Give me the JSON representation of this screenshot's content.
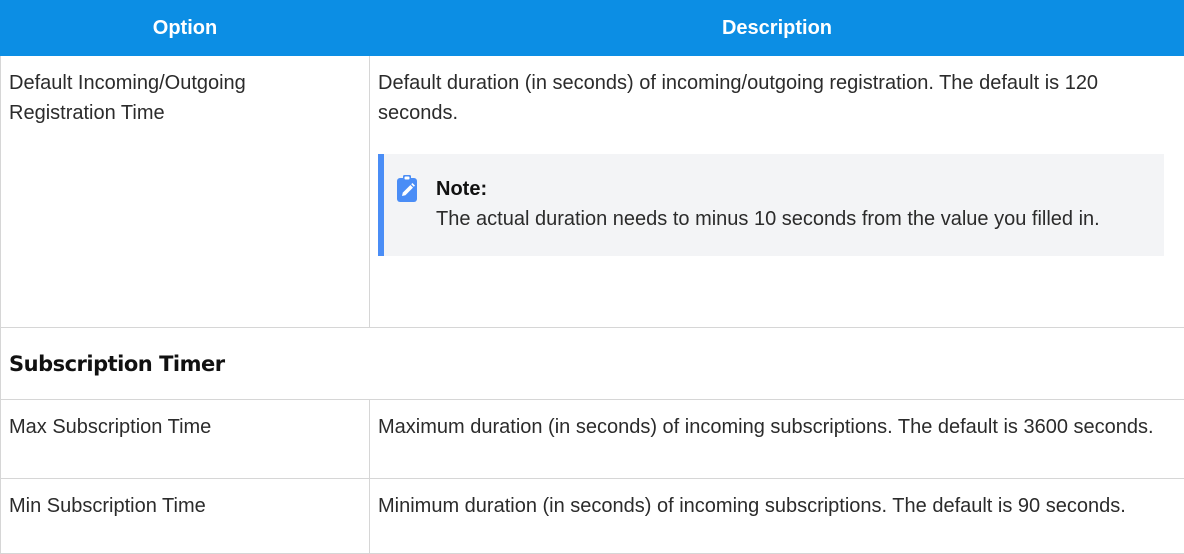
{
  "table": {
    "headers": [
      "Option",
      "Description"
    ],
    "rows": [
      {
        "option": "Default Incoming/Outgoing Registration Time",
        "description": "Default duration (in seconds) of incoming/outgoing registration. The default is 120 seconds.",
        "note": {
          "title": "Note:",
          "text": "The actual duration needs to minus 10 seconds from the value you filled in.",
          "icon": "edit-pencil-icon"
        }
      }
    ],
    "section": "Subscription Timer",
    "subscription_rows": [
      {
        "option": "Max Subscription Time",
        "description": "Maximum duration (in seconds) of incoming subscriptions. The default is 3600 seconds."
      },
      {
        "option": "Min Subscription Time",
        "description": "Minimum duration (in seconds) of incoming subscriptions. The default is 90 seconds."
      }
    ]
  },
  "colors": {
    "header_bg": "#0c8ee4",
    "note_accent": "#4a8df6",
    "note_bg": "#f3f4f6"
  }
}
